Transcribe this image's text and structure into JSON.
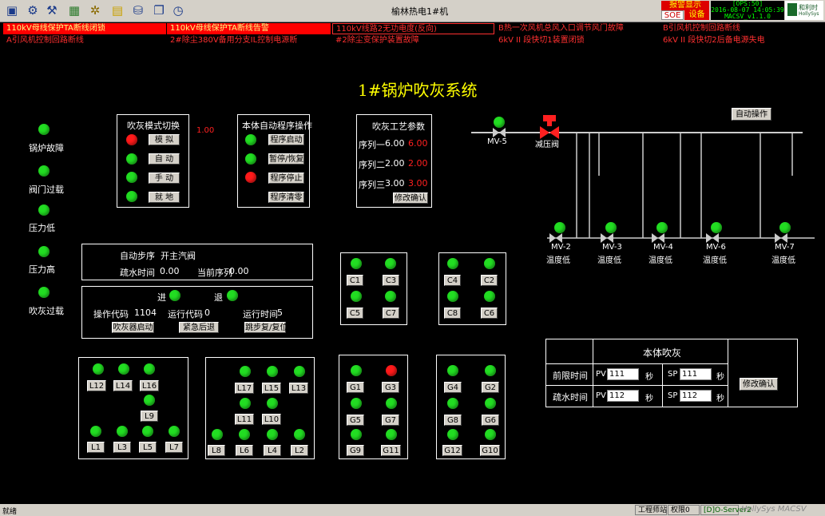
{
  "window": {
    "title": "榆林热电1#机"
  },
  "alarm_panel": {
    "show_label": "报警显示",
    "soe_label": "SOE",
    "device_label": "设备",
    "ops_label": "[OPS:50]",
    "datetime": "2016-08-07 14:05:39",
    "version": "MACSV_v1.1.0",
    "logo_text": "和利时",
    "logo_sub": "HollySys"
  },
  "alarms": [
    "110kV母线保护TA断线闭锁",
    "110kV母线保护TA断线告警",
    "110kV线路2无功电度(反向)",
    "B热一次风机总风入口调节风门故障",
    "B引风机控制回路断线",
    "A引风机控制回路断线",
    "2#除尘380V备用分支IL控制电源断",
    "#2除尘变保护装置故障",
    "6kV II 段快切1装置闭锁",
    "6kV II 段快切2后备电源失电"
  ],
  "main_title": "1#锅炉吹灰系统",
  "left_status": [
    "锅炉故障",
    "阀门过载",
    "压力低",
    "压力高",
    "吹灰过载"
  ],
  "mode_panel": {
    "title": "吹灰模式切换",
    "value": "1.00",
    "buttons": [
      "模 拟",
      "自 动",
      "手 动",
      "就 地"
    ]
  },
  "auto_panel": {
    "title": "本体自动程序操作",
    "buttons": [
      "程序启动",
      "暂停/恢复",
      "程序停止",
      "程序清零"
    ]
  },
  "param_panel": {
    "title": "吹灰工艺参数",
    "rows": [
      {
        "label": "序列一",
        "v1": "6.00",
        "v2": "6.00"
      },
      {
        "label": "序列二",
        "v1": "2.00",
        "v2": "2.00"
      },
      {
        "label": "序列三",
        "v1": "3.00",
        "v2": "3.00"
      }
    ],
    "confirm_label": "修改确认"
  },
  "auto_op_button": "自动操作",
  "valves": {
    "mv5": "MV-5",
    "reducer": "减压阀",
    "list": [
      {
        "name": "MV-2",
        "status": "温度低"
      },
      {
        "name": "MV-3",
        "status": "温度低"
      },
      {
        "name": "MV-4",
        "status": "温度低"
      },
      {
        "name": "MV-6",
        "status": "温度低"
      },
      {
        "name": "MV-7",
        "status": "温度低"
      }
    ]
  },
  "step_panel": {
    "step_label": "自动步序",
    "step_value": "开主汽阀",
    "drain_label": "疏水时间",
    "drain_value": "0.00",
    "seq_label": "当前序列",
    "seq_value": "0.00"
  },
  "op_panel": {
    "in_label": "进",
    "out_label": "退",
    "opcode_label": "操作代码",
    "opcode_value": "1104",
    "runcode_label": "运行代码",
    "runcode_value": "0",
    "runtime_label": "运行时间",
    "runtime_value": "5",
    "btn_start": "吹灰器启动",
    "btn_retreat": "紧急后退",
    "btn_reset": "跳步复/复位"
  },
  "c_group1": [
    "C1",
    "C3",
    "C5",
    "C7"
  ],
  "c_group2": [
    "C4",
    "C2",
    "C8",
    "C6"
  ],
  "l_group1": [
    "L12",
    "L14",
    "L16",
    "L9",
    "L1",
    "L3",
    "L5",
    "L7"
  ],
  "l_group2": [
    "L17",
    "L15",
    "L13",
    "L11",
    "L10",
    "L8",
    "L6",
    "L4",
    "L2"
  ],
  "g_group1": [
    "G1",
    "G3",
    "G5",
    "G7",
    "G9",
    "G11"
  ],
  "g_group2": [
    "G4",
    "G2",
    "G8",
    "G6",
    "G12",
    "G10"
  ],
  "body_blow": {
    "title": "本体吹灰",
    "rows": [
      {
        "label": "前限时间",
        "pv_label": "PV",
        "pv": "111",
        "pv_unit": "秒",
        "sp_label": "SP",
        "sp": "111",
        "sp_unit": "秒"
      },
      {
        "label": "疏水时间",
        "pv_label": "PV",
        "pv": "112",
        "pv_unit": "秒",
        "sp_label": "SP",
        "sp": "112",
        "sp_unit": "秒"
      }
    ],
    "confirm_label": "修改确认"
  },
  "statusbar": {
    "ready": "就绪",
    "engineer": "工程师站",
    "auth": "权限0",
    "server": "[D]O-Server2",
    "brand": "HollySys MACSV"
  },
  "colors": {
    "ok": "#22dd22",
    "fault": "#ff1a1a",
    "accent": "#ffff00"
  }
}
